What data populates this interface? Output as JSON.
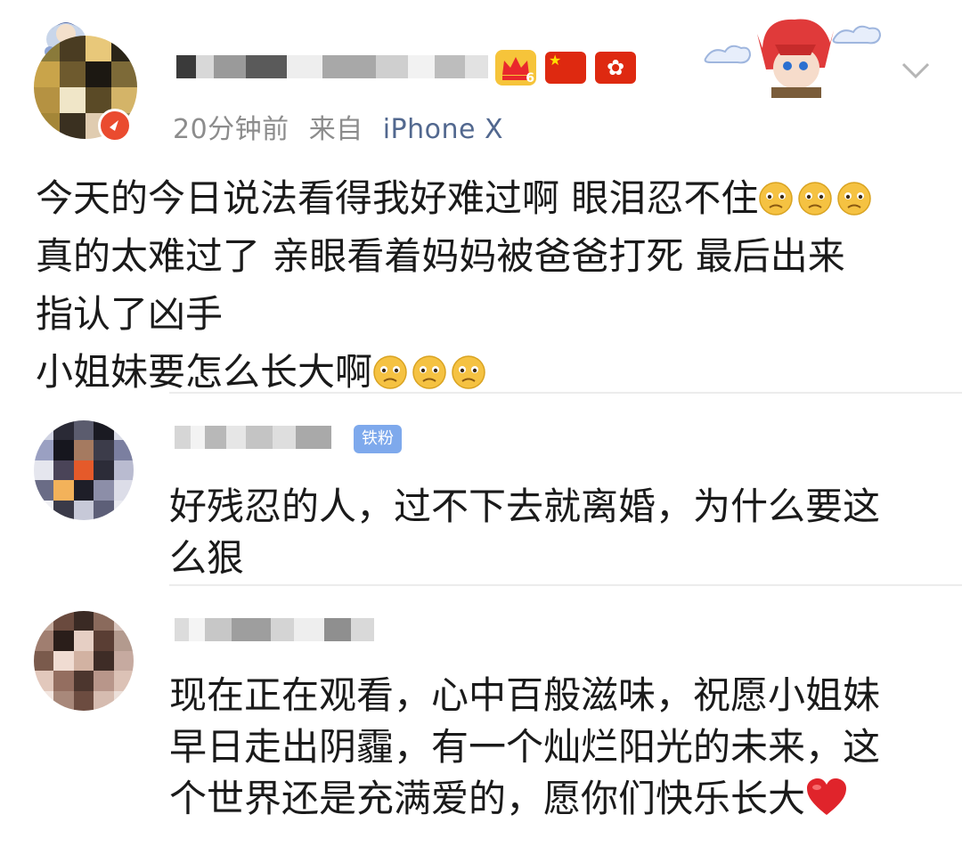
{
  "post": {
    "time": "20分钟前",
    "source_prefix": "来自",
    "device": "iPhone X",
    "level_badge": "6",
    "lines": [
      "今天的今日说法看得我好难过啊 眼泪忍不住",
      "真的太难过了 亲眼看着妈妈被爸爸打死 最后出来",
      "指认了凶手",
      "小姐妹要怎么长大啊"
    ],
    "line1_emoji_icon": "sad-emoji-icon",
    "line4_emoji_icon": "sad-emoji-icon",
    "emoji_color": "#f5c242"
  },
  "comments": [
    {
      "badge": "铁粉",
      "lines": [
        "好残忍的人，过不下去就离婚，为什么要这",
        "么狠"
      ]
    },
    {
      "lines": [
        "现在正在观看，心中百般滋味，祝愿小姐妹",
        "早日走出阴霾，有一个灿烂阳光的未来，这",
        "个世界还是充满爱的，愿你们快乐长大"
      ],
      "end_icon": "red-heart-icon"
    }
  ],
  "colors": {
    "text": "#1a1a1a",
    "meta": "#8c8c8c",
    "device": "#52688f",
    "fan_badge": "#7ea9ec",
    "heart": "#e0242b"
  }
}
